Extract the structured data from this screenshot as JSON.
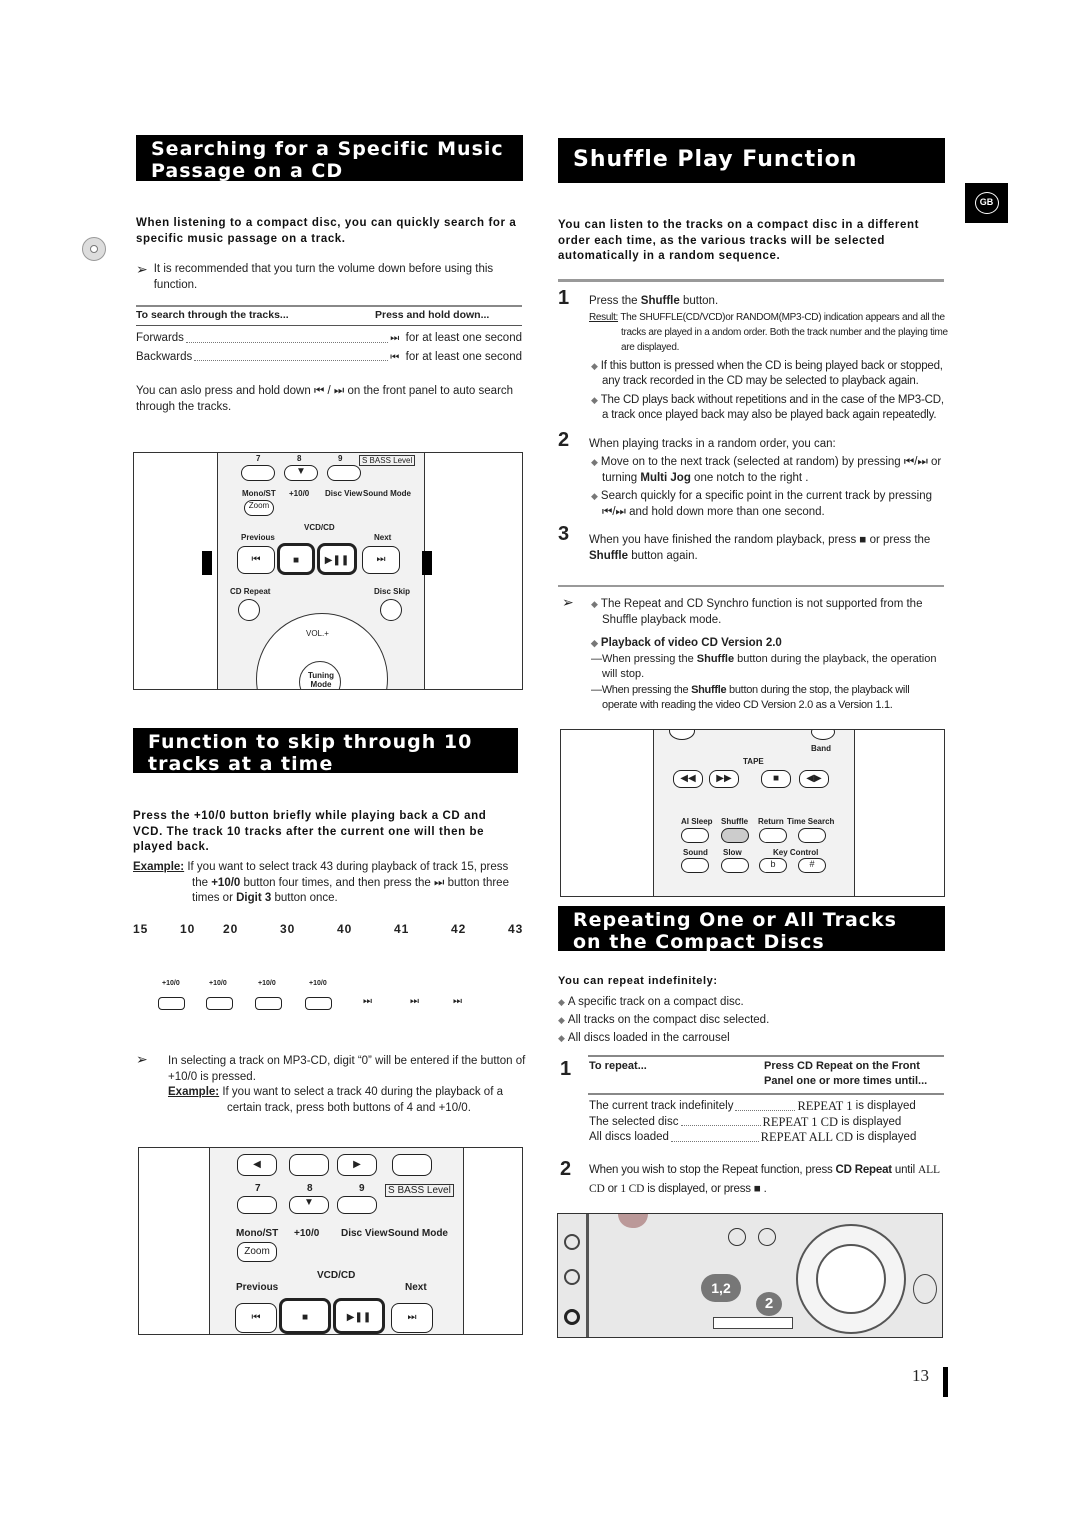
{
  "left": {
    "search": {
      "title_line1": "Searching for a Specific Music",
      "title_line2": "Passage on a CD",
      "intro": "When listening to a compact disc, you can quickly search for a specific music passage on a track.",
      "note": "It is recommended that you turn the volume down before using this function.",
      "table_head": [
        "To search through the tracks...",
        "Press and hold down..."
      ],
      "rows": [
        {
          "label": "Forwards",
          "icon": "⏭",
          "value": "for at least one second"
        },
        {
          "label": "Backwards",
          "icon": "⏮",
          "value": "for at least one second"
        }
      ],
      "extra_a": "You can aslo press and hold down",
      "extra_b": "on the front panel to auto search through the tracks.",
      "remote_labels": [
        "7",
        "8",
        "9",
        "S BASS Level",
        "Mono/ST",
        "+10/0",
        "Disc View",
        "Sound Mode",
        "Zoom",
        "VCD/CD",
        "Previous",
        "Next",
        "CD Repeat",
        "Disc Skip",
        "VOL.+",
        "Tuning Mode"
      ]
    },
    "skip": {
      "title_line1": "Function to skip through 10",
      "title_line2": "tracks at a time",
      "intro": "Press the +10/0 button briefly while playing back a CD and VCD. The track 10 tracks after the current one will then be played back.",
      "example_label": "Example:",
      "example_1": "If you want to select track 43 during playback of track 15, press the",
      "example_bold": "+10/0",
      "example_2": "button four times, and then press the",
      "example_3": "button three times or",
      "example_digit": "Digit 3",
      "example_4": "button once.",
      "sequence": [
        "15",
        "10",
        "20",
        "30",
        "40",
        "41",
        "42",
        "43"
      ],
      "button_labels": [
        "+10/0",
        "+10/0",
        "+10/0",
        "+10/0"
      ],
      "note": "In selecting a track on MP3-CD, digit “0” will be entered if the button of +10/0 is pressed.",
      "note_example_label": "Example:",
      "note_example": "If you want to select a track 40 during the playback of a certain track, press both buttons of 4 and +10/0.",
      "remote_labels": [
        "7",
        "8",
        "9",
        "S BASS Level",
        "Mono/ST",
        "+10/0",
        "Disc View",
        "Sound Mode",
        "Zoom",
        "VCD/CD",
        "Previous",
        "Next"
      ]
    }
  },
  "right": {
    "shuffle": {
      "title": "Shuffle Play Function",
      "intro": "You can listen to the tracks on a compact disc in a different order each time, as the various tracks will be selected automatically in a random sequence.",
      "step1_a": "Press the",
      "step1_b": "Shuffle",
      "step1_c": "button.",
      "result_label": "Result:",
      "result": "The SHUFFLE(CD/VCD)or RANDOM(MP3-CD) indication appears and all the tracks are played in a andom order. Both the track number and the playing time are displayed.",
      "bullet1": "If this button is pressed when the CD is being played back or stopped, any track recorded in the CD may be selected to playback again.",
      "bullet2": "The CD plays back without repetitions and in the case of the MP3-CD, a track once played back may also be played back again repeatedly.",
      "step2": "When playing tracks in a random order, you can:",
      "step2_b1": "Move on to the next track (selected at random) by pressing",
      "step2_b1b": "or turning",
      "step2_b1c": "Multi Jog",
      "step2_b1d": "one notch to the right .",
      "step2_b2": "Search quickly for a specific point in the current track by pressing",
      "step2_b2b": "and hold down more than one second.",
      "step3_a": "When you have finished the random playback, press",
      "step3_b": "or press the",
      "step3_c": "Shuffle",
      "step3_d": "button again.",
      "note1": "The Repeat and CD Synchro function is not supported from the Shuffle playback mode.",
      "note2_title": "Playback of video CD Version 2.0",
      "note2_a1": "—When pressing the",
      "note2_a2": "Shuffle",
      "note2_a3": "button during the playback, the operation will stop.",
      "note2_b1": "—When pressing the",
      "note2_b2": "Shuffle",
      "note2_b3": "button during the stop, the playback will operate with reading the video CD Version 2.0 as a Version 1.1.",
      "remote_labels": [
        "Band",
        "TAPE",
        "AI Sleep",
        "Shuffle",
        "Return",
        "Time Search",
        "Sound",
        "Slow",
        "Key Control",
        "b",
        "#"
      ]
    },
    "repeat": {
      "title_line1": "Repeating One or All Tracks",
      "title_line2": "on the Compact Discs",
      "intro": "You can repeat indefinitely:",
      "bullets": [
        "A specific track on a compact disc.",
        "All tracks on the compact disc selected.",
        "All discs loaded in the carrousel"
      ],
      "table_head": [
        "To repeat...",
        "Press CD Repeat on the Front Panel one or more times until..."
      ],
      "rows": [
        {
          "label": "The current track indefinitely",
          "code": "REPEAT 1",
          "suffix": "is displayed"
        },
        {
          "label": "The selected disc",
          "code": "REPEAT 1 CD",
          "suffix": "is displayed"
        },
        {
          "label": "All discs loaded",
          "code": "REPEAT ALL CD",
          "suffix": "is displayed"
        }
      ],
      "step2_a": "When you wish to stop the Repeat function, press",
      "step2_b": "CD Repeat",
      "step2_c": "until",
      "step2_d": "ALL CD",
      "step2_e": "or",
      "step2_f": "1 CD",
      "step2_g": "is displayed, or press",
      "step2_h": ".",
      "panel_callouts": [
        "1,2",
        "2"
      ]
    }
  },
  "steps": [
    "1",
    "2",
    "3"
  ],
  "language_badge": "GB",
  "page_number": "13"
}
